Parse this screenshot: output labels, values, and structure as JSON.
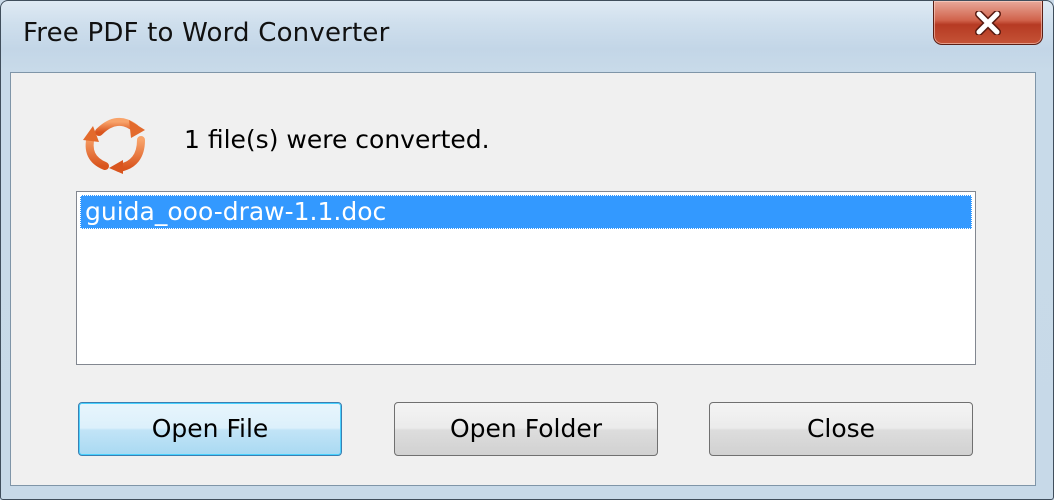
{
  "window": {
    "title": "Free PDF to Word Converter"
  },
  "icons": {
    "app": "converter-cycle-icon",
    "close": "close-icon"
  },
  "message": "1 file(s) were converted.",
  "files": [
    {
      "name": "guida_ooo-draw-1.1.doc",
      "selected": true
    }
  ],
  "buttons": {
    "open_file": "Open File",
    "open_folder": "Open Folder",
    "close": "Close"
  },
  "colors": {
    "selection": "#3399ff",
    "close_button": "#c55337",
    "default_button_border": "#3c7fb1"
  }
}
